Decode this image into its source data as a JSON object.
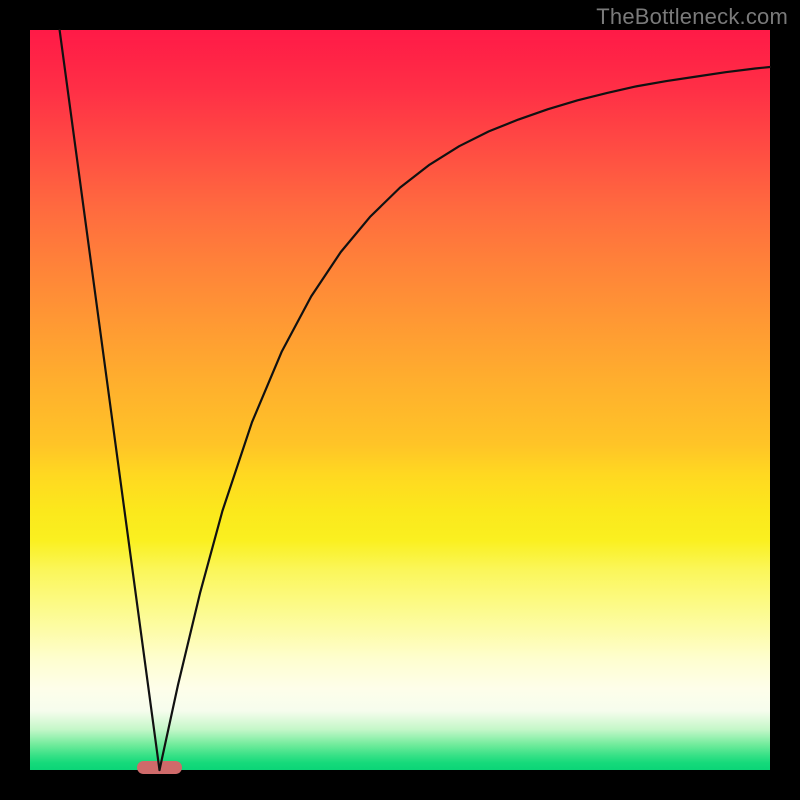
{
  "watermark": "TheBottleneck.com",
  "colors": {
    "frame": "#000000",
    "curve": "#111111",
    "marker": "#cf6a6a",
    "gradient_top": "#ff1a47",
    "gradient_bottom": "#0bd577"
  },
  "chart_data": {
    "type": "line",
    "title": "",
    "xlabel": "",
    "ylabel": "",
    "xlim": [
      0,
      1
    ],
    "ylim": [
      0,
      1
    ],
    "background": "vertical-gradient red→orange→yellow→pale→green",
    "marker": {
      "x_start": 0.145,
      "x_end": 0.205,
      "y": 0.0
    },
    "series": [
      {
        "name": "left-line",
        "x": [
          0.04,
          0.175
        ],
        "y": [
          1.0,
          0.0
        ]
      },
      {
        "name": "right-curve",
        "x": [
          0.175,
          0.2,
          0.23,
          0.26,
          0.3,
          0.34,
          0.38,
          0.42,
          0.46,
          0.5,
          0.54,
          0.58,
          0.62,
          0.66,
          0.7,
          0.74,
          0.78,
          0.82,
          0.86,
          0.9,
          0.94,
          0.98,
          1.0
        ],
        "y": [
          0.0,
          0.115,
          0.24,
          0.35,
          0.47,
          0.565,
          0.64,
          0.7,
          0.748,
          0.787,
          0.818,
          0.843,
          0.863,
          0.879,
          0.893,
          0.905,
          0.915,
          0.924,
          0.931,
          0.937,
          0.943,
          0.948,
          0.95
        ]
      }
    ]
  }
}
